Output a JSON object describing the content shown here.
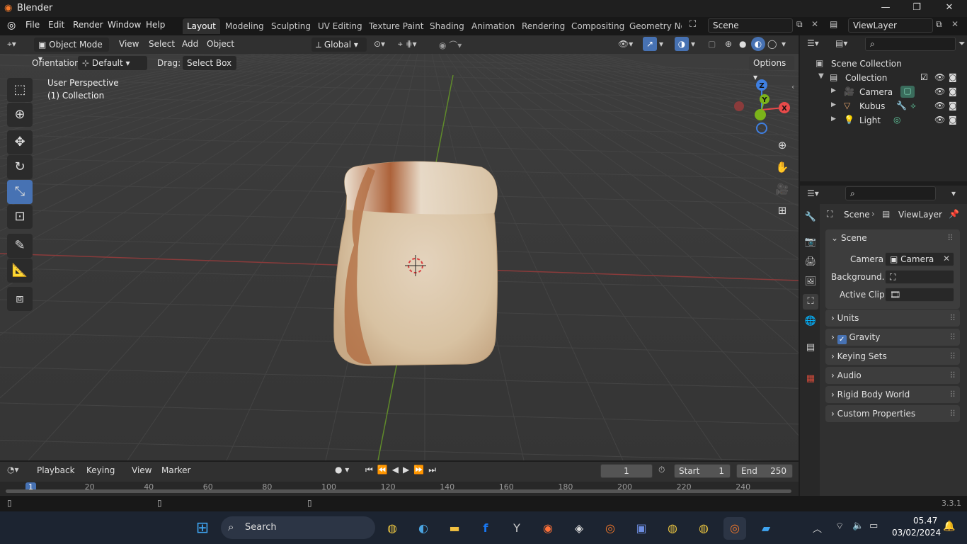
{
  "app": {
    "title": "Blender",
    "version": "3.3.1"
  },
  "window_controls": {
    "minimize": "—",
    "maximize": "❐",
    "close": "✕"
  },
  "menu": [
    "File",
    "Edit",
    "Render",
    "Window",
    "Help"
  ],
  "workspaces": [
    "Layout",
    "Modeling",
    "Sculpting",
    "UV Editing",
    "Texture Paint",
    "Shading",
    "Animation",
    "Rendering",
    "Compositing",
    "Geometry Noc"
  ],
  "scene_selector": "Scene",
  "viewlayer_selector": "ViewLayer",
  "viewport_header": {
    "mode": "Object Mode",
    "menus": [
      "View",
      "Select",
      "Add",
      "Object"
    ],
    "transform": "Global"
  },
  "tool_settings": {
    "orientation_label": "Orientation:",
    "orientation_value": "Default",
    "drag_label": "Drag:",
    "drag_value": "Select Box",
    "options": "Options"
  },
  "viewport": {
    "perspective": "User Perspective",
    "collection": "(1) Collection"
  },
  "gizmo": {
    "x": "X",
    "y": "Y",
    "z": "Z",
    "x_color": "#e84a4a",
    "y_color": "#7bb31a",
    "z_color": "#3f7fe0"
  },
  "outliner": {
    "root": "Scene Collection",
    "collection": "Collection",
    "items": [
      "Camera",
      "Kubus",
      "Light"
    ]
  },
  "properties": {
    "breadcrumb_scene": "Scene",
    "breadcrumb_viewlayer": "ViewLayer",
    "panel_title": "Scene",
    "camera_label": "Camera",
    "camera_value": "Camera",
    "background_label": "Background...",
    "active_clip_label": "Active Clip",
    "panels": [
      "Units",
      "Gravity",
      "Keying Sets",
      "Audio",
      "Rigid Body World",
      "Custom Properties"
    ]
  },
  "timeline": {
    "menus": [
      "Playback",
      "Keying",
      "View",
      "Marker"
    ],
    "current_frame": "1",
    "start_label": "Start",
    "start_value": "1",
    "end_label": "End",
    "end_value": "250",
    "ruler": [
      "1",
      "20",
      "40",
      "60",
      "80",
      "100",
      "120",
      "140",
      "160",
      "180",
      "200",
      "220",
      "240"
    ]
  },
  "taskbar": {
    "search": "Search",
    "time": "05.47",
    "date": "03/02/2024"
  }
}
